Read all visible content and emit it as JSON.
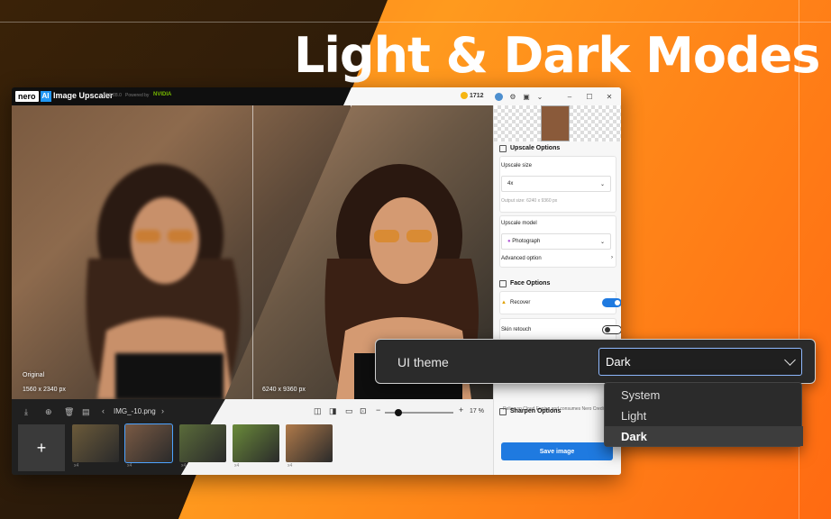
{
  "headline": "Light & Dark Modes",
  "app": {
    "logo_text": "nero",
    "logo_ai": "AI",
    "name": "Image Upscaler",
    "version": "26.5.28.0",
    "powered_by": "Powered by",
    "partner": "NVIDIA",
    "credits": "1712"
  },
  "viewer": {
    "original_label": "Original",
    "original_size": "1560 x 2340 px",
    "result_size": "6240 x 9360 px",
    "file_name": "IMG_-10.png",
    "zoom": "17 %",
    "zoom_fraction": 0.2
  },
  "thumbnails": [
    {
      "scale": "x4",
      "color": "#6b5a3a"
    },
    {
      "scale": "x4",
      "color": "#7a5a44"
    },
    {
      "scale": "x4",
      "color": "#5a6b3a"
    },
    {
      "scale": "x4",
      "color": "#6a8a3a"
    },
    {
      "scale": "x4",
      "color": "#b07a4a"
    }
  ],
  "panel": {
    "upscale_options": "Upscale Options",
    "upscale_size_label": "Upscale size",
    "upscale_size_value": "4x",
    "output_size": "Output size: 6240 x 9360 px",
    "upscale_model_label": "Upscale model",
    "upscale_model_value": "Photograph",
    "advanced_option": "Advanced option",
    "face_options": "Face Options",
    "recover": "Recover",
    "recover_on": true,
    "skin_retouch": "Skin retouch",
    "skin_retouch_on": false,
    "cloud_note": "Relies on Cloud Engine and consumes Nero Credits.",
    "sharpen_options": "Sharpen Options",
    "save_image": "Save image"
  },
  "theme": {
    "label": "UI theme",
    "value": "Dark",
    "options": [
      "System",
      "Light",
      "Dark"
    ],
    "selected_index": 2
  },
  "colors": {
    "accent": "#1f7ae0",
    "orange": "#ff8a1a",
    "dark_bg": "#2b2b2b"
  }
}
